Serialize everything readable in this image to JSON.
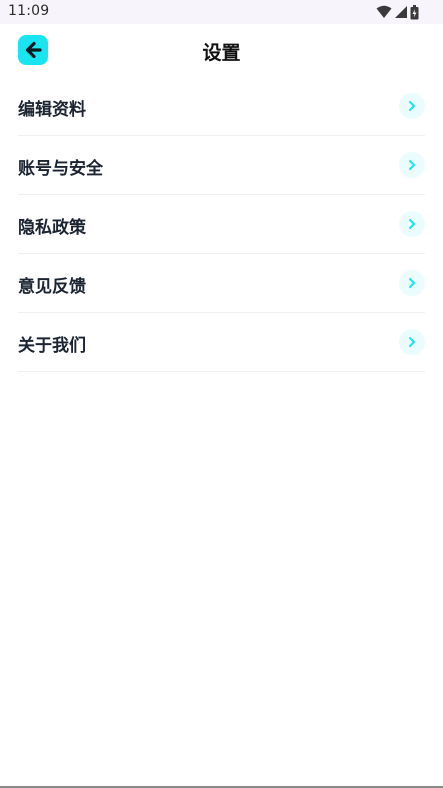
{
  "status_bar": {
    "time": "11:09",
    "icons": [
      "wifi-icon",
      "signal-icon",
      "battery-icon"
    ]
  },
  "header": {
    "title": "设置",
    "back_icon": "back-arrow-icon",
    "accent_color": "#19e5f0"
  },
  "menu": {
    "items": [
      {
        "label": "编辑资料",
        "icon": "chevron-right-icon"
      },
      {
        "label": "账号与安全",
        "icon": "chevron-right-icon"
      },
      {
        "label": "隐私政策",
        "icon": "chevron-right-icon"
      },
      {
        "label": "意见反馈",
        "icon": "chevron-right-icon"
      },
      {
        "label": "关于我们",
        "icon": "chevron-right-icon"
      }
    ]
  }
}
